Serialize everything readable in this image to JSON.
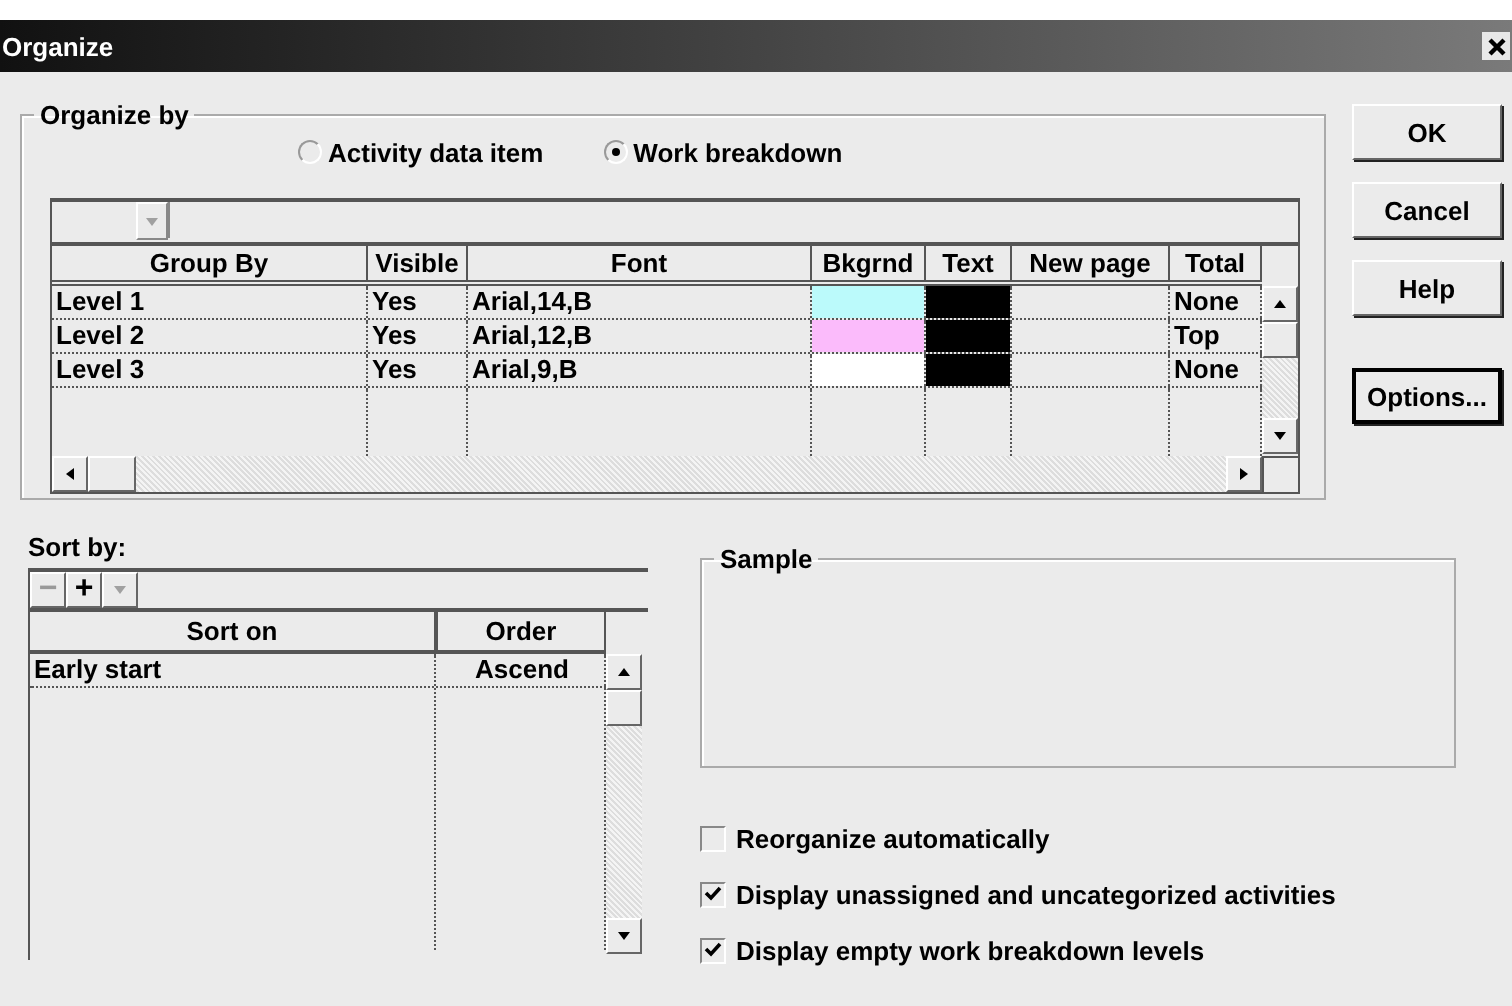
{
  "window": {
    "title": "Organize"
  },
  "organize_by": {
    "label": "Organize by",
    "options": [
      {
        "label": "Activity data item",
        "selected": false
      },
      {
        "label": "Work breakdown",
        "selected": true
      }
    ]
  },
  "group_table": {
    "columns": [
      "Group By",
      "Visible",
      "Font",
      "Bkgrnd",
      "Text",
      "New page",
      "Total"
    ],
    "rows": [
      {
        "group_by": "Level 1",
        "visible": "Yes",
        "font": "Arial,14,B",
        "bkgrnd": {
          "color": "#bbfafb"
        },
        "text": {
          "color": "#000000"
        },
        "total": "None"
      },
      {
        "group_by": "Level 2",
        "visible": "Yes",
        "font": "Arial,12,B",
        "bkgrnd": {
          "color": "#fbbbfb"
        },
        "text": {
          "color": "#000000"
        },
        "total": "Top"
      },
      {
        "group_by": "Level 3",
        "visible": "Yes",
        "font": "Arial,9,B",
        "bkgrnd": {
          "color": "#ffffff"
        },
        "text": {
          "color": "#000000"
        },
        "total": "None"
      }
    ]
  },
  "sort_by": {
    "label": "Sort by:",
    "tools": [
      {
        "label": "−",
        "disabled": true
      },
      {
        "label": "+",
        "disabled": false
      }
    ],
    "columns": [
      "Sort on",
      "Order"
    ],
    "rows": [
      {
        "sort_on": "Early start",
        "order": "Ascend"
      }
    ]
  },
  "sample": {
    "label": "Sample"
  },
  "checkboxes": [
    {
      "label": "Reorganize automatically",
      "checked": false
    },
    {
      "label": "Display unassigned and uncategorized activities",
      "checked": true
    },
    {
      "label": "Display empty work breakdown levels",
      "checked": true
    }
  ],
  "buttons": [
    {
      "label": "OK",
      "default": false
    },
    {
      "label": "Cancel",
      "default": false
    },
    {
      "label": "Help",
      "default": false
    },
    {
      "label": "Options...",
      "default": true
    }
  ]
}
